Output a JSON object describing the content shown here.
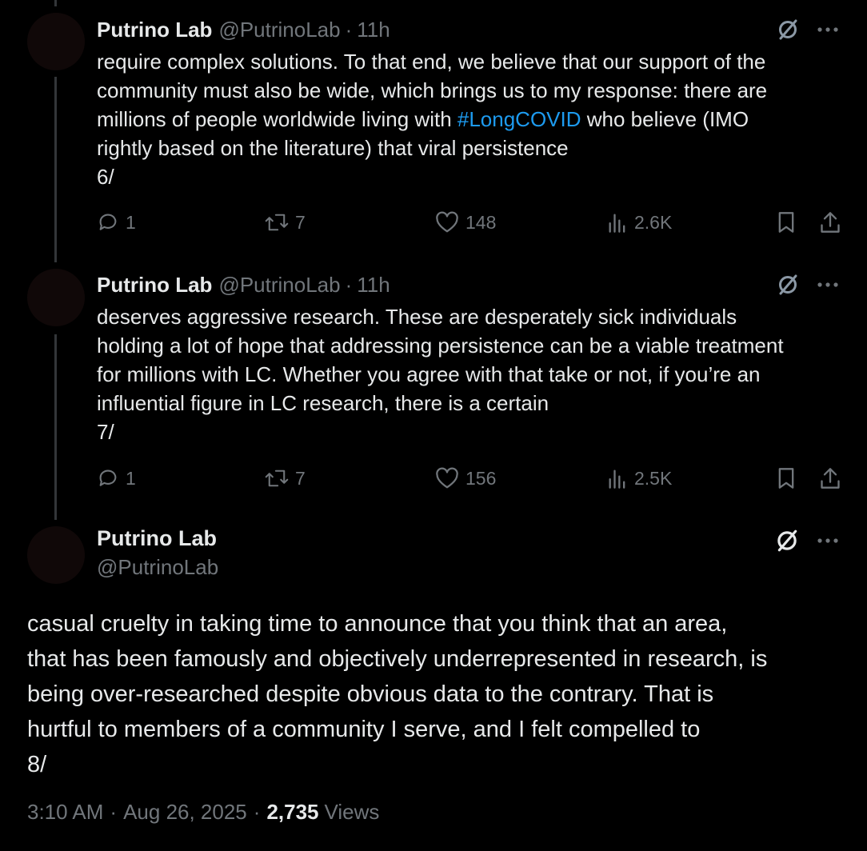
{
  "tweets": [
    {
      "name": "Putrino Lab",
      "handle": "@PutrinoLab",
      "separator": "·",
      "time": "11h",
      "text_before": "require complex solutions. To that end, we believe that our support of the\ncommunity must also be wide, which brings us to my response: there are\nmillions of people worldwide living with ",
      "hashtag": "#LongCOVID",
      "text_after": " who believe (IMO\nrightly based on the literature) that viral persistence\n6/",
      "replies": "1",
      "reposts": "7",
      "likes": "148",
      "views": "2.6K"
    },
    {
      "name": "Putrino Lab",
      "handle": "@PutrinoLab",
      "separator": "·",
      "time": "11h",
      "text": "deserves aggressive research. These are desperately sick individuals\nholding a lot of hope that addressing persistence can be a viable treatment\nfor millions with LC. Whether you agree with that take or not, if you’re an\ninfluential figure in LC research, there is a certain\n7/",
      "replies": "1",
      "reposts": "7",
      "likes": "156",
      "views": "2.5K"
    }
  ],
  "main_tweet": {
    "name": "Putrino Lab",
    "handle": "@PutrinoLab",
    "text": "casual cruelty in taking time to announce that you think that an area,\nthat has been famously and objectively underrepresented in research, is\nbeing over-researched despite obvious data to the contrary. That is\nhurtful to members of a community I serve, and I felt compelled to\n8/",
    "time": "3:10 AM",
    "separator": "·",
    "date": "Aug 26, 2025",
    "views_count": "2,735",
    "views_label": "Views"
  },
  "icons": {
    "grok": "grok-icon",
    "more": "more-icon",
    "reply": "reply-icon",
    "repost": "repost-icon",
    "like": "heart-icon",
    "views": "views-icon",
    "bookmark": "bookmark-icon",
    "share": "share-icon"
  },
  "colors": {
    "background": "#000000",
    "text": "#e7e9ea",
    "secondary": "#71767b",
    "link": "#1d9bf0",
    "thread_line": "#333639"
  }
}
